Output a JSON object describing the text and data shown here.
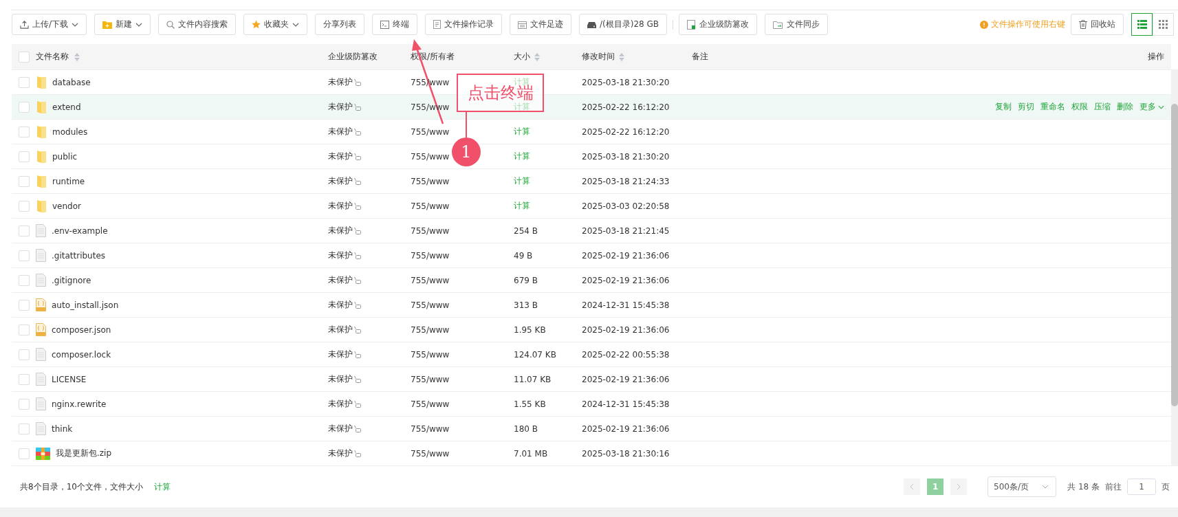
{
  "toolbar": {
    "buttons": [
      {
        "label": "上传/下载",
        "dropdown": true
      },
      {
        "label": "新建",
        "dropdown": true
      },
      {
        "label": "文件内容搜索",
        "dropdown": false
      },
      {
        "label": "收藏夹",
        "dropdown": true
      },
      {
        "label": "分享列表",
        "dropdown": false
      },
      {
        "label": "终端",
        "dropdown": false
      },
      {
        "label": "文件操作记录",
        "dropdown": false
      },
      {
        "label": "文件足迹",
        "dropdown": false
      },
      {
        "label": "/(根目录)28 GB",
        "dropdown": false
      },
      {
        "label": "企业级防篡改",
        "dropdown": false
      },
      {
        "label": "文件同步",
        "dropdown": false
      }
    ],
    "hint": "文件操作可使用右键",
    "recycle": "回收站",
    "views": [
      {
        "kind": "list",
        "selected": true
      },
      {
        "kind": "grid",
        "selected": false
      }
    ]
  },
  "table": {
    "all_checked": false,
    "columns": [
      "文件名称",
      "企业级防篡改",
      "权限/所有者",
      "大小",
      "修改时间",
      "备注",
      "操作"
    ],
    "rows": [
      {
        "kind": "folder",
        "name": "database",
        "protect": "未保护",
        "perm": "755/www",
        "size": "计算",
        "time": "2025-03-18 21:30:20",
        "highlighted": false
      },
      {
        "kind": "folder",
        "name": "extend",
        "protect": "未保护",
        "perm": "755/www",
        "size": "计算",
        "time": "2025-02-22 16:12:20",
        "highlighted": true,
        "actions": [
          "复制",
          "剪切",
          "重命名",
          "权限",
          "压缩",
          "删除",
          "更多"
        ]
      },
      {
        "kind": "folder",
        "name": "modules",
        "protect": "未保护",
        "perm": "755/www",
        "size": "计算",
        "time": "2025-02-22 16:12:20",
        "highlighted": false
      },
      {
        "kind": "folder",
        "name": "public",
        "protect": "未保护",
        "perm": "755/www",
        "size": "计算",
        "time": "2025-03-18 21:30:20",
        "highlighted": false
      },
      {
        "kind": "folder",
        "name": "runtime",
        "protect": "未保护",
        "perm": "755/www",
        "size": "计算",
        "time": "2025-03-18 21:24:33",
        "highlighted": false
      },
      {
        "kind": "folder",
        "name": "vendor",
        "protect": "未保护",
        "perm": "755/www",
        "size": "计算",
        "time": "2025-03-03 02:20:58",
        "highlighted": false
      },
      {
        "kind": "file",
        "name": ".env-example",
        "protect": "未保护",
        "perm": "755/www",
        "size": "254 B",
        "time": "2025-03-18 21:21:45",
        "highlighted": false
      },
      {
        "kind": "file",
        "name": ".gitattributes",
        "protect": "未保护",
        "perm": "755/www",
        "size": "49 B",
        "time": "2025-02-19 21:36:06",
        "highlighted": false
      },
      {
        "kind": "file",
        "name": ".gitignore",
        "protect": "未保护",
        "perm": "755/www",
        "size": "679 B",
        "time": "2025-02-19 21:36:06",
        "highlighted": false
      },
      {
        "kind": "json",
        "name": "auto_install.json",
        "protect": "未保护",
        "perm": "755/www",
        "size": "313 B",
        "time": "2024-12-31 15:45:38",
        "highlighted": false
      },
      {
        "kind": "json",
        "name": "composer.json",
        "protect": "未保护",
        "perm": "755/www",
        "size": "1.95 KB",
        "time": "2025-02-19 21:36:06",
        "highlighted": false
      },
      {
        "kind": "file",
        "name": "composer.lock",
        "protect": "未保护",
        "perm": "755/www",
        "size": "124.07 KB",
        "time": "2025-02-22 00:55:38",
        "highlighted": false
      },
      {
        "kind": "file",
        "name": "LICENSE",
        "protect": "未保护",
        "perm": "755/www",
        "size": "11.07 KB",
        "time": "2025-02-19 21:36:06",
        "highlighted": false
      },
      {
        "kind": "file",
        "name": "nginx.rewrite",
        "protect": "未保护",
        "perm": "755/www",
        "size": "1.55 KB",
        "time": "2024-12-31 15:45:38",
        "highlighted": false
      },
      {
        "kind": "file",
        "name": "think",
        "protect": "未保护",
        "perm": "755/www",
        "size": "180 B",
        "time": "2025-02-19 21:36:06",
        "highlighted": false
      },
      {
        "kind": "zip",
        "name": "我是更新包.zip",
        "protect": "未保护",
        "perm": "755/www",
        "size": "7.01 MB",
        "time": "2025-03-18 21:30:16",
        "highlighted": false
      }
    ]
  },
  "footer": {
    "summary": "共8个目录，10个文件，文件大小",
    "calc": "计算",
    "pages": [
      {
        "label": "1",
        "selected": true
      }
    ],
    "page_size": "500条/页",
    "total": "共 18 条",
    "goto": "前往",
    "goto_value": "1",
    "page_unit": "页"
  },
  "annotation": {
    "label": "点击终端",
    "step": "1"
  }
}
